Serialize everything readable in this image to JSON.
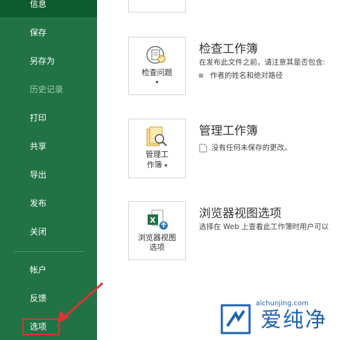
{
  "sidebar": {
    "items": [
      {
        "label": "信息"
      },
      {
        "label": "保存"
      },
      {
        "label": "另存为"
      },
      {
        "label": "历史记录"
      },
      {
        "label": "打印"
      },
      {
        "label": "共享"
      },
      {
        "label": "导出"
      },
      {
        "label": "发布"
      },
      {
        "label": "关闭"
      },
      {
        "label": "帐户"
      },
      {
        "label": "反馈"
      },
      {
        "label": "选项"
      }
    ]
  },
  "sections": {
    "inspect": {
      "button_label": "检查问题",
      "title": "检查工作簿",
      "description": "在发布此文件之前，请注意其是否包含:",
      "bullet": "作者的姓名和绝对路径"
    },
    "manage": {
      "button_label_line1": "管理工",
      "button_label_line2": "作簿",
      "title": "管理工作簿",
      "description": "没有任何未保存的更改。"
    },
    "browser": {
      "button_label_line1": "浏览器视图",
      "button_label_line2": "选项",
      "title": "浏览器视图选项",
      "description": "选择在 Web 上查看此工作簿时用户可以"
    }
  },
  "watermark": {
    "text": "爱纯净",
    "url": "aichunjing.com"
  },
  "colors": {
    "sidebar": "#217346",
    "selected": "#0e5c2f",
    "highlight": "#e03232"
  }
}
